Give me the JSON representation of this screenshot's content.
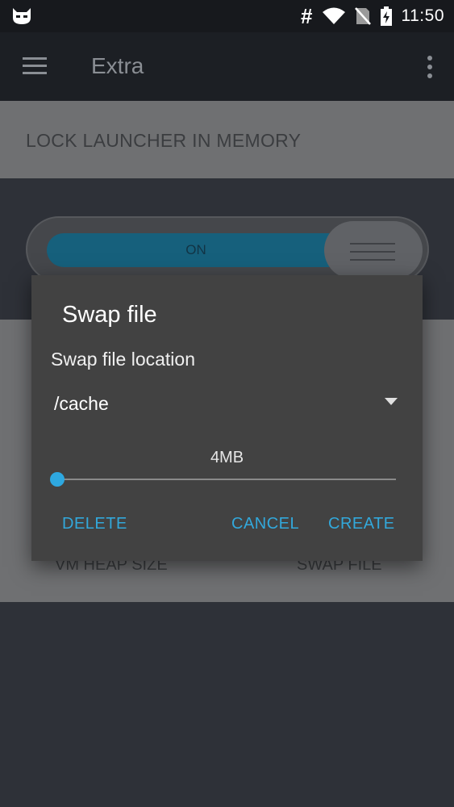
{
  "status_bar": {
    "time": "11:50",
    "hash_glyph": "#",
    "icons": [
      "cyanogen-logo-icon",
      "hash-icon",
      "wifi-icon",
      "no-sim-icon",
      "battery-charging-icon"
    ]
  },
  "app_bar": {
    "title": "Extra",
    "icons": [
      "menu-icon",
      "overflow-menu-icon"
    ]
  },
  "background": {
    "lock_label": "LOCK LAUNCHER IN MEMORY",
    "toggle_label": "ON",
    "lower_left": "VM HEAP SIZE",
    "lower_right": "SWAP FILE"
  },
  "dialog": {
    "title": "Swap file",
    "subtitle": "Swap file location",
    "location_value": "/cache",
    "size_value": "4MB",
    "slider_fraction": 0.0,
    "buttons": {
      "delete": "DELETE",
      "cancel": "CANCEL",
      "create": "CREATE"
    }
  },
  "colors": {
    "accent": "#32a8db",
    "dialog_bg": "#424242",
    "app_bar": "#1c1f24",
    "status_bar": "#17191d"
  }
}
